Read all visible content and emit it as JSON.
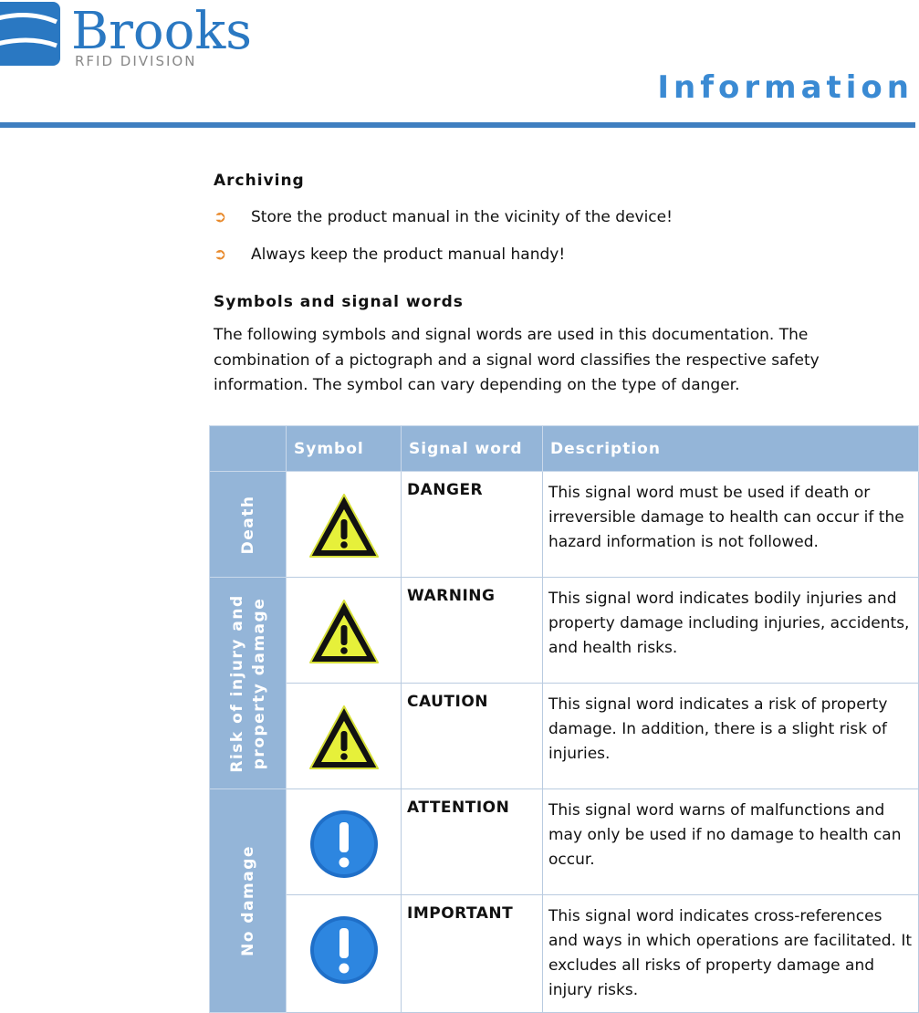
{
  "header": {
    "logo_text": "Brooks",
    "logo_sub": "RFID DIVISION",
    "title": "Information"
  },
  "archiving": {
    "heading": "Archiving",
    "bullets": [
      "Store the product manual in the vicinity of the device!",
      "Always keep the product manual handy!"
    ]
  },
  "symbols": {
    "heading": "Symbols and signal words",
    "text": "The following symbols and signal words are used in this documentation. The combination of a pictograph and a signal word classifies the respective safety information. The symbol can vary depending on the type of danger."
  },
  "table": {
    "headers": [
      "",
      "Symbol",
      "Signal word",
      "Description"
    ],
    "groups": [
      "Death",
      "Risk of injury and property damage",
      "No damage"
    ],
    "rows": [
      {
        "icon": "warning-triangle",
        "word": "DANGER",
        "desc": "This signal word must be used if death or irreversible damage to health can occur if the hazard information is not followed."
      },
      {
        "icon": "warning-triangle",
        "word": "WARNING",
        "desc": "This signal word indicates bodily injuries and property damage including injuries, accidents, and health risks."
      },
      {
        "icon": "warning-triangle",
        "word": "CAUTION",
        "desc": "This signal word indicates a risk of property damage. In addition, there is a slight risk of injuries."
      },
      {
        "icon": "info-exclamation-circle",
        "word": "ATTENTION",
        "desc": "This signal word warns of malfunctions and may only be used if no damage to health can occur."
      },
      {
        "icon": "info-exclamation-circle",
        "word": "IMPORTANT",
        "desc": "This signal word indicates cross-references and ways in which operations are facilitated. It excludes all risks of property damage and injury risks."
      }
    ]
  },
  "colors": {
    "accent": "#3a8ad3",
    "table_header": "#94b5d8",
    "bullet": "#e8892b"
  }
}
